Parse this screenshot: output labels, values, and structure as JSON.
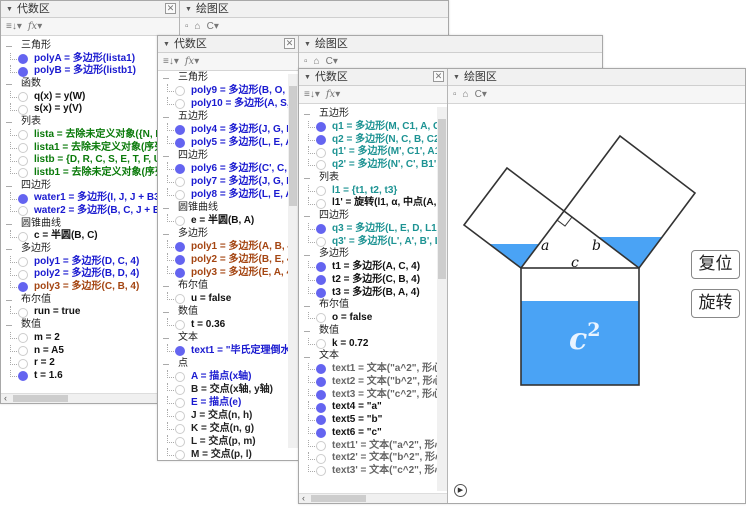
{
  "colors": {
    "blue": "#1a1ad0",
    "green": "#0a7a0a",
    "brown": "#a44512",
    "teal": "#1d9393",
    "water": "#4aa3f5",
    "point_on": "#6464f0"
  },
  "toolbar": {
    "alg_icons": [
      "sort-lines-icon",
      "sort-menu-icon",
      "fx-icon"
    ],
    "alg_sort": "≡↓▾",
    "alg_fx": "fx▾",
    "gfx_home": "⌂",
    "gfx_style": "C▾"
  },
  "windows": [
    {
      "algebra_title": "代数区",
      "graphics_title": "绘图区",
      "items": [
        {
          "g": "三角形"
        },
        {
          "t": "polyA = 多边形(lista1)",
          "c": "b",
          "on": true
        },
        {
          "t": "polyB = 多边形(listb1)",
          "c": "b",
          "on": true
        },
        {
          "g": "函数"
        },
        {
          "t": "q(x) = y(W)",
          "c": "k"
        },
        {
          "t": "s(x) = y(V)",
          "c": "k"
        },
        {
          "g": "列表"
        },
        {
          "t": "lista = 去除未定义对象({N, D, C",
          "c": "g"
        },
        {
          "t": "lista1 = 去除未定义对象(序列(",
          "c": "g"
        },
        {
          "t": "listb = {D, R, C, S, E, T, F, U}",
          "c": "g"
        },
        {
          "t": "listb1 = 去除未定义对象(序列(",
          "c": "g"
        },
        {
          "g": "四边形"
        },
        {
          "t": "water1 = 多边形(I, J, J + B3 (C",
          "c": "b",
          "on": true
        },
        {
          "t": "water2 = 多边形(B, C, J + B5 (C",
          "c": "b"
        },
        {
          "g": "圆锥曲线"
        },
        {
          "t": "c = 半圆(B, C)",
          "c": "k"
        },
        {
          "g": "多边形"
        },
        {
          "t": "poly1 = 多边形(D, C, 4)",
          "c": "b"
        },
        {
          "t": "poly2 = 多边形(B, D, 4)",
          "c": "b"
        },
        {
          "t": "poly3 = 多边形(C, B, 4)",
          "c": "r",
          "on": true
        },
        {
          "g": "布尔值"
        },
        {
          "t": "run = true",
          "c": "k"
        },
        {
          "g": "数值"
        },
        {
          "t": "m = 2",
          "c": "k"
        },
        {
          "t": "n = A5",
          "c": "k"
        },
        {
          "t": "r = 2",
          "c": "k"
        },
        {
          "t": "t = 1.6",
          "c": "k",
          "on": true
        }
      ]
    },
    {
      "algebra_title": "代数区",
      "graphics_title": "绘图区",
      "items": [
        {
          "g": "三角形"
        },
        {
          "t": "poly9 = 多边形(B, O, R)",
          "c": "b"
        },
        {
          "t": "poly10 = 多边形(A, S, P)",
          "c": "b"
        },
        {
          "g": "五边形"
        },
        {
          "t": "poly4 = 多边形(J, G, B, E,",
          "c": "b",
          "on": true
        },
        {
          "t": "poly5 = 多边形(L, E, A, H,",
          "c": "b",
          "on": true
        },
        {
          "g": "四边形"
        },
        {
          "t": "poly6 = 多边形(C', C, D, N",
          "c": "b",
          "on": true
        },
        {
          "t": "poly7 = 多边形(J, G, B, O)",
          "c": "b"
        },
        {
          "t": "poly8 = 多边形(L, E, A, P)",
          "c": "b"
        },
        {
          "g": "圆锥曲线"
        },
        {
          "t": "e = 半圆(B, A)",
          "c": "k"
        },
        {
          "g": "多边形"
        },
        {
          "t": "poly1 = 多边形(A, B, 4)",
          "c": "r",
          "on": true
        },
        {
          "t": "poly2 = 多边形(B, E, 4)",
          "c": "r",
          "on": true
        },
        {
          "t": "poly3 = 多边形(E, A, 4)",
          "c": "r",
          "on": true
        },
        {
          "g": "布尔值"
        },
        {
          "t": "u = false",
          "c": "k"
        },
        {
          "g": "数值"
        },
        {
          "t": "t = 0.36",
          "c": "k"
        },
        {
          "g": "文本"
        },
        {
          "t": "text1 = \"毕氏定理倒水法",
          "c": "b",
          "on": true
        },
        {
          "g": "点"
        },
        {
          "t": "A = 描点(x轴)",
          "c": "b"
        },
        {
          "t": "B = 交点(x轴, y轴)",
          "c": "n"
        },
        {
          "t": "E = 描点(e)",
          "c": "b"
        },
        {
          "t": "J = 交点(n, h)",
          "c": "n"
        },
        {
          "t": "K = 交点(n, g)",
          "c": "n"
        },
        {
          "t": "L = 交点(p, m)",
          "c": "n"
        },
        {
          "t": "M = 交点(p, l)",
          "c": "n"
        }
      ]
    },
    {
      "algebra_title": "代数区",
      "graphics_title": "绘图区",
      "items": [
        {
          "g": "五边形"
        },
        {
          "t": "q1 = 多边形(M, C1, A, C, I",
          "c": "t",
          "on": true
        },
        {
          "t": "q2 = 多边形(N, C, B, C2, N",
          "c": "t",
          "on": true
        },
        {
          "t": "q1' = 多边形(M', C1', A1',",
          "c": "t"
        },
        {
          "t": "q2' = 多边形(N', C', B1', C",
          "c": "t"
        },
        {
          "g": "列表"
        },
        {
          "t": "l1 = {t1, t2, t3}",
          "c": "t"
        },
        {
          "t": "l1' = 旋转(l1, α, 中点(A, B",
          "c": "k"
        },
        {
          "g": "四边形"
        },
        {
          "t": "q3 = 多边形(L, E, D, L1)",
          "c": "t",
          "on": true
        },
        {
          "t": "q3' = 多边形(L', A', B', L1",
          "c": "t"
        },
        {
          "g": "多边形"
        },
        {
          "t": "t1 = 多边形(A, C, 4)",
          "c": "k",
          "on": true
        },
        {
          "t": "t2 = 多边形(C, B, 4)",
          "c": "k",
          "on": true
        },
        {
          "t": "t3 = 多边形(B, A, 4)",
          "c": "k",
          "on": true
        },
        {
          "g": "布尔值"
        },
        {
          "t": "o = false",
          "c": "k"
        },
        {
          "g": "数值"
        },
        {
          "t": "k = 0.72",
          "c": "k"
        },
        {
          "g": "文本"
        },
        {
          "t": "text1 = 文本(\"a^2\", 形心",
          "c": "gy",
          "on": true
        },
        {
          "t": "text2 = 文本(\"b^2\", 形心",
          "c": "gy",
          "on": true
        },
        {
          "t": "text3 = 文本(\"c^2\", 形心",
          "c": "gy",
          "on": true
        },
        {
          "t": "text4 = \"a\"",
          "c": "k",
          "on": true
        },
        {
          "t": "text5 = \"b\"",
          "c": "k",
          "on": true
        },
        {
          "t": "text6 = \"c\"",
          "c": "k",
          "on": true
        },
        {
          "t": "text1' = 文本(\"a^2\", 形心",
          "c": "gy"
        },
        {
          "t": "text2' = 文本(\"b^2\", 形心",
          "c": "gy"
        },
        {
          "t": "text3' = 文本(\"c^2\", 形心",
          "c": "gy"
        }
      ]
    }
  ],
  "graphics": {
    "label_a": "a",
    "label_b": "b",
    "label_c": "c",
    "label_c2": "c",
    "label_c2_exp": "2",
    "water_level_c_square": 0.72,
    "reset_button": "复位",
    "rotate_button": "旋转",
    "play_icon": "▶"
  }
}
